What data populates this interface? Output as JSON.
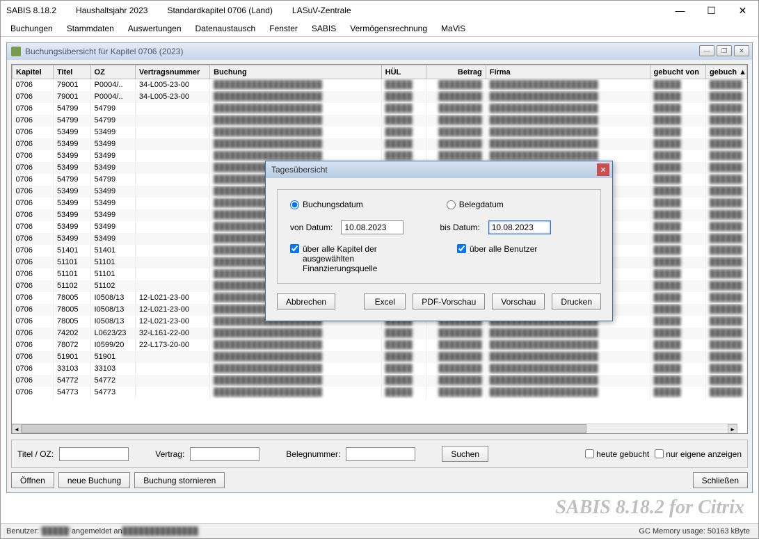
{
  "titlebar": {
    "app": "SABIS 8.18.2",
    "year": "Haushaltsjahr 2023",
    "chapter": "Standardkapitel 0706  (Land)",
    "org": "LASuV-Zentrale"
  },
  "menu": [
    "Buchungen",
    "Stammdaten",
    "Auswertungen",
    "Datenaustausch",
    "Fenster",
    "SABIS",
    "Vermögensrechnung",
    "MaViS"
  ],
  "child": {
    "title": "Buchungsübersicht für Kapitel 0706 (2023)"
  },
  "columns": [
    "Kapitel",
    "Titel",
    "OZ",
    "Vertragsnummer",
    "Buchung",
    "HÜL",
    "Betrag",
    "Firma",
    "gebucht von",
    "gebuch"
  ],
  "rows": [
    {
      "k": "0706",
      "t": "79001",
      "oz": "P0004/..",
      "vn": "34-L005-23-00"
    },
    {
      "k": "0706",
      "t": "79001",
      "oz": "P0004/..",
      "vn": "34-L005-23-00"
    },
    {
      "k": "0706",
      "t": "54799",
      "oz": "54799",
      "vn": ""
    },
    {
      "k": "0706",
      "t": "54799",
      "oz": "54799",
      "vn": ""
    },
    {
      "k": "0706",
      "t": "53499",
      "oz": "53499",
      "vn": ""
    },
    {
      "k": "0706",
      "t": "53499",
      "oz": "53499",
      "vn": ""
    },
    {
      "k": "0706",
      "t": "53499",
      "oz": "53499",
      "vn": ""
    },
    {
      "k": "0706",
      "t": "53499",
      "oz": "53499",
      "vn": ""
    },
    {
      "k": "0706",
      "t": "54799",
      "oz": "54799",
      "vn": ""
    },
    {
      "k": "0706",
      "t": "53499",
      "oz": "53499",
      "vn": ""
    },
    {
      "k": "0706",
      "t": "53499",
      "oz": "53499",
      "vn": ""
    },
    {
      "k": "0706",
      "t": "53499",
      "oz": "53499",
      "vn": ""
    },
    {
      "k": "0706",
      "t": "53499",
      "oz": "53499",
      "vn": ""
    },
    {
      "k": "0706",
      "t": "53499",
      "oz": "53499",
      "vn": ""
    },
    {
      "k": "0706",
      "t": "51401",
      "oz": "51401",
      "vn": ""
    },
    {
      "k": "0706",
      "t": "51101",
      "oz": "51101",
      "vn": ""
    },
    {
      "k": "0706",
      "t": "51101",
      "oz": "51101",
      "vn": ""
    },
    {
      "k": "0706",
      "t": "51102",
      "oz": "51102",
      "vn": ""
    },
    {
      "k": "0706",
      "t": "78005",
      "oz": "I0508/13",
      "vn": "12-L021-23-00"
    },
    {
      "k": "0706",
      "t": "78005",
      "oz": "I0508/13",
      "vn": "12-L021-23-00"
    },
    {
      "k": "0706",
      "t": "78005",
      "oz": "I0508/13",
      "vn": "12-L021-23-00"
    },
    {
      "k": "0706",
      "t": "74202",
      "oz": "L0623/23",
      "vn": "32-L161-22-00"
    },
    {
      "k": "0706",
      "t": "78072",
      "oz": "I0599/20",
      "vn": "22-L173-20-00"
    },
    {
      "k": "0706",
      "t": "51901",
      "oz": "51901",
      "vn": ""
    },
    {
      "k": "0706",
      "t": "33103",
      "oz": "33103",
      "vn": ""
    },
    {
      "k": "0706",
      "t": "54772",
      "oz": "54772",
      "vn": ""
    },
    {
      "k": "0706",
      "t": "54773",
      "oz": "54773",
      "vn": ""
    }
  ],
  "filter": {
    "label_titel": "Titel / OZ:",
    "label_vertrag": "Vertrag:",
    "label_beleg": "Belegnummer:",
    "btn_search": "Suchen",
    "cb_today": "heute gebucht",
    "cb_own": "nur eigene anzeigen"
  },
  "buttons": {
    "open": "Öffnen",
    "new": "neue Buchung",
    "cancel": "Buchung stornieren",
    "close": "Schließen"
  },
  "dialog": {
    "title": "Tagesübersicht",
    "radio1": "Buchungsdatum",
    "radio2": "Belegdatum",
    "from_label": "von Datum:",
    "to_label": "bis Datum:",
    "from": "10.08.2023",
    "to": "10.08.2023",
    "cb1": "über alle Kapitel der ausgewählten Finanzierungsquelle",
    "cb2": "über alle Benutzer",
    "btn_cancel": "Abbrechen",
    "btn_excel": "Excel",
    "btn_pdf": "PDF-Vorschau",
    "btn_preview": "Vorschau",
    "btn_print": "Drucken"
  },
  "status": {
    "user_label": "Benutzer: ",
    "user": "\"█████\"",
    "logged": "   angemeldet an ",
    "server": "██████████████",
    "gc": "GC Memory usage: 50163 kByte"
  },
  "watermark": "SABIS 8.18.2 for Citrix"
}
